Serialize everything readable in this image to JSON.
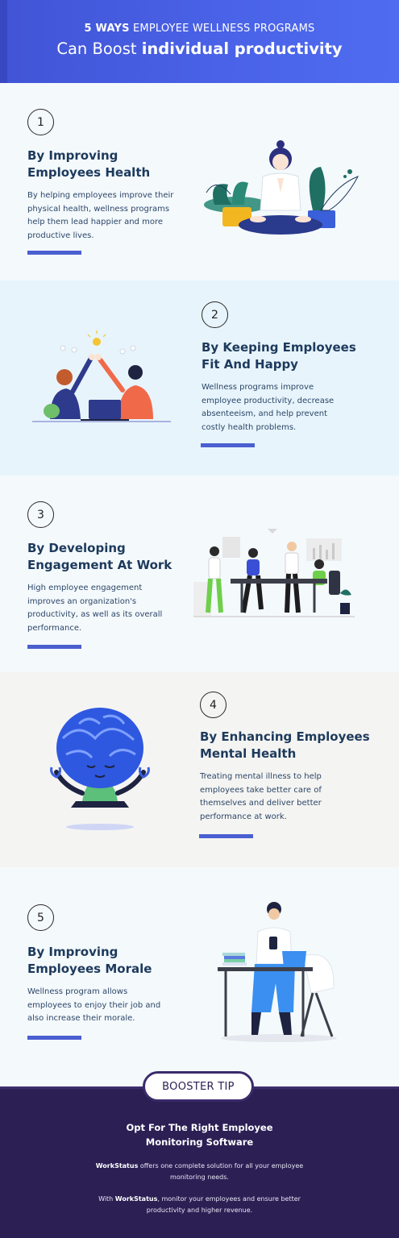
{
  "header": {
    "line1_bold": "5 WAYS",
    "line1_rest": " EMPLOYEE WELLNESS PROGRAMS",
    "line2_rest": "Can Boost ",
    "line2_bold": "individual productivity"
  },
  "sections": [
    {
      "number": "1",
      "title_line1": "By Improving",
      "title_line2": "Employees Health",
      "desc_lines": [
        "By helping employees improve their",
        "physical health, wellness programs",
        "help them lead happier and more",
        "productive lives."
      ],
      "illustration": "meditating-woman-with-plants"
    },
    {
      "number": "2",
      "title_line1": "By Keeping Employees",
      "title_line2": "Fit And Happy",
      "desc_lines": [
        "Wellness programs improve",
        "employee productivity, decrease",
        "absenteeism, and help prevent",
        "costly health problems."
      ],
      "illustration": "coworkers-high-five"
    },
    {
      "number": "3",
      "title_line1": "By Developing",
      "title_line2": "Engagement At Work",
      "desc_lines": [
        "High employee engagement",
        "improves an organization's",
        "productivity, as well as its overall",
        "performance."
      ],
      "illustration": "team-meeting-office"
    },
    {
      "number": "4",
      "title_line1": "By Enhancing Employees",
      "title_line2": "Mental Health",
      "desc_lines": [
        "Treating mental illness to help",
        "employees take better care of",
        "themselves and deliver better",
        "performance at work."
      ],
      "illustration": "meditating-brain"
    },
    {
      "number": "5",
      "title_line1": "By Improving",
      "title_line2": "Employees Morale",
      "desc_lines": [
        "Wellness program allows",
        "employees to enjoy their job and",
        "also increase their morale."
      ],
      "illustration": "man-at-desk-with-laptop"
    }
  ],
  "booster": {
    "tip_label": "BOOSTER TIP",
    "title_line1": "Opt For The Right Employee",
    "title_line2": "Monitoring Software",
    "p1_bold": "WorkStatus",
    "p1_rest": " offers one complete solution for all your employee",
    "p1_line2": "monitoring needs.",
    "p2_start": "With ",
    "p2_bold": "WorkStatus",
    "p2_rest": ", monitor your employees and ensure better",
    "p2_line2": "productivity and higher revenue."
  },
  "colors": {
    "header_bg": "#4a63e8",
    "accent_bar": "#4a5fd0",
    "title_text": "#1d3a5c",
    "booster_bg": "#2b1f54"
  }
}
